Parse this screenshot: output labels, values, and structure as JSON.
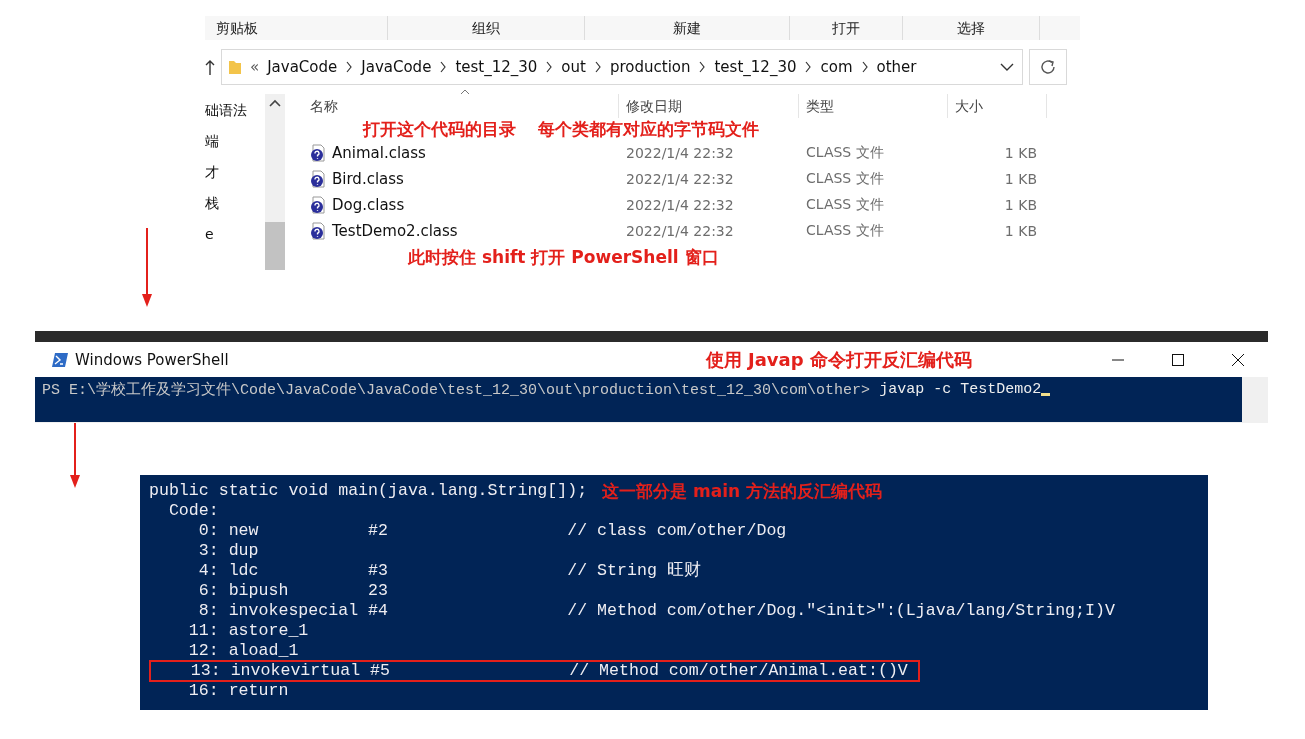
{
  "explorer": {
    "ribbon_groups": [
      "剪贴板",
      "组织",
      "新建",
      "打开",
      "选择"
    ],
    "address_prefix": "«",
    "breadcrumb": [
      "JavaCode",
      "JavaCode",
      "test_12_30",
      "out",
      "production",
      "test_12_30",
      "com",
      "other"
    ],
    "nav_items": [
      "础语法",
      "端",
      "才",
      "栈",
      "e"
    ],
    "columns": [
      "名称",
      "修改日期",
      "类型",
      "大小"
    ],
    "annotations": [
      "打开这个代码的目录",
      "每个类都有对应的字节码文件"
    ],
    "rows": [
      {
        "name": "Animal.class",
        "modified": "2022/1/4 22:32",
        "type": "CLASS 文件",
        "size": "1 KB"
      },
      {
        "name": "Bird.class",
        "modified": "2022/1/4 22:32",
        "type": "CLASS 文件",
        "size": "1 KB"
      },
      {
        "name": "Dog.class",
        "modified": "2022/1/4 22:32",
        "type": "CLASS 文件",
        "size": "1 KB"
      },
      {
        "name": "TestDemo2.class",
        "modified": "2022/1/4 22:32",
        "type": "CLASS 文件",
        "size": "1 KB"
      }
    ],
    "note": "此时按住 shift 打开 PowerShell 窗口"
  },
  "powershell": {
    "title": "Windows PowerShell",
    "annotation": "使用 Javap 命令打开反汇编代码",
    "prompt": "PS E:\\学校工作及学习文件\\Code\\JavaCode\\JavaCode\\test_12_30\\out\\production\\test_12_30\\com\\other>",
    "command": "javap -c TestDemo2"
  },
  "disassembly": {
    "header": "public static void main(java.lang.String[]);",
    "annotation": "这一部分是 main 方法的反汇编代码",
    "lines": [
      {
        "text": "  Code:",
        "highlighted": false
      },
      {
        "text": "     0: new           #2                  // class com/other/Dog",
        "highlighted": false
      },
      {
        "text": "     3: dup",
        "highlighted": false
      },
      {
        "text": "     4: ldc           #3                  // String 旺财",
        "highlighted": false
      },
      {
        "text": "     6: bipush        23",
        "highlighted": false
      },
      {
        "text": "     8: invokespecial #4                  // Method com/other/Dog.\"<init>\":(Ljava/lang/String;I)V",
        "highlighted": false
      },
      {
        "text": "    11: astore_1",
        "highlighted": false
      },
      {
        "text": "    12: aload_1",
        "highlighted": false
      },
      {
        "text": "    13: invokevirtual #5                  // Method com/other/Animal.eat:()V",
        "highlighted": true
      },
      {
        "text": "    16: return",
        "highlighted": false
      }
    ]
  }
}
